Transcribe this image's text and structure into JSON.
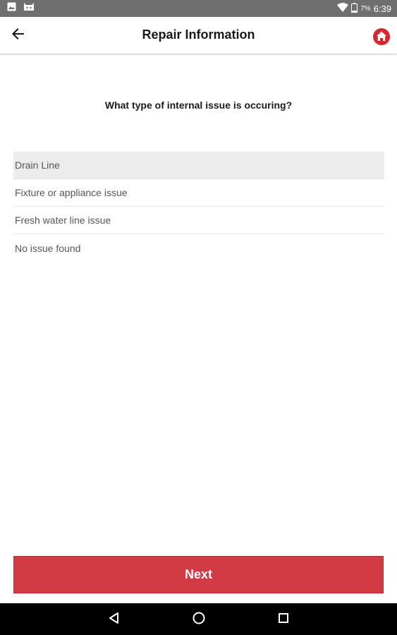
{
  "status_bar": {
    "battery_percent": "7%",
    "time": "6:39",
    "icons": [
      "image-icon",
      "cat-icon",
      "wifi-icon",
      "battery-icon"
    ]
  },
  "app_bar": {
    "title": "Repair Information",
    "back_icon": "arrow-back-icon",
    "home_icon": "home-icon"
  },
  "question": "What type of internal issue is occuring?",
  "options": [
    {
      "label": "Drain Line",
      "selected": true
    },
    {
      "label": "Fixture or appliance issue",
      "selected": false
    },
    {
      "label": "Fresh water line issue",
      "selected": false
    },
    {
      "label": "No issue found",
      "selected": false
    }
  ],
  "next_label": "Next",
  "nav_bar": {
    "icons": [
      "back-triangle-icon",
      "home-circle-icon",
      "recents-square-icon"
    ]
  },
  "colors": {
    "status_bar": "#6f6f6f",
    "accent": "#d23a44",
    "selected_row": "#ececec",
    "nav_bar": "#000000"
  }
}
